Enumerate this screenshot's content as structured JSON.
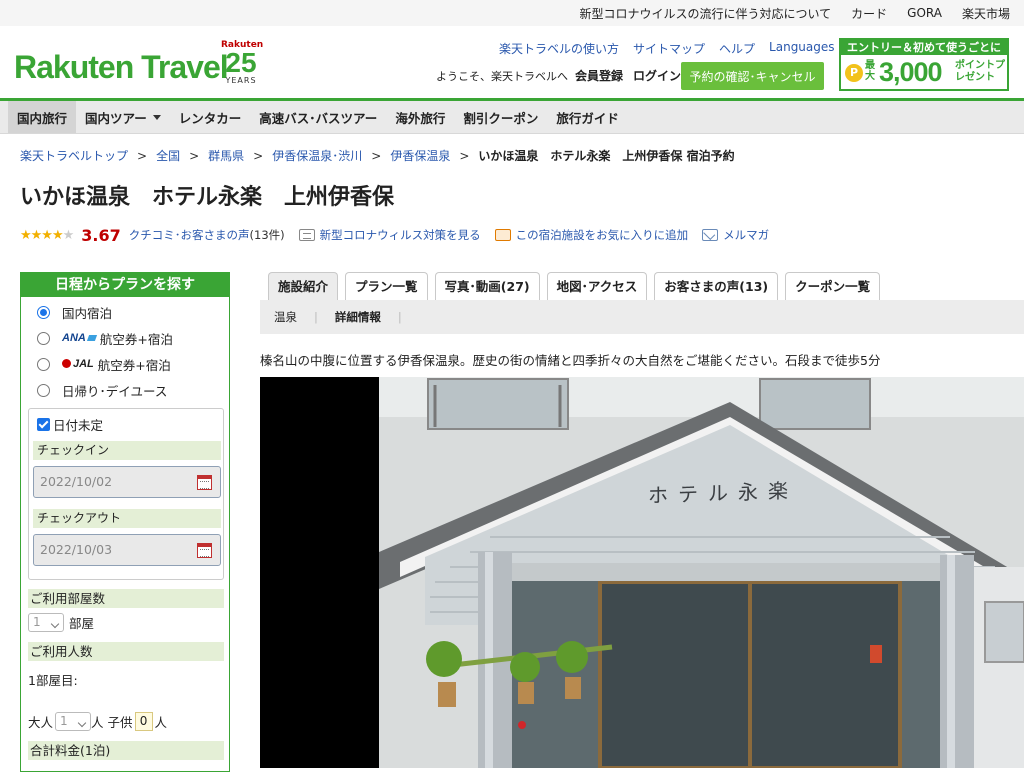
{
  "topbar": {
    "links": [
      "新型コロナウイルスの流行に伴う対応について",
      "カード",
      "GORA",
      "楽天市場"
    ]
  },
  "header": {
    "logo": "Rakuten Travel",
    "anniversary": {
      "brand": "Rakuten",
      "number": "25",
      "suffix": "YEARS"
    },
    "links": [
      "楽天トラベルの使い方",
      "サイトマップ",
      "ヘルプ",
      "Languages"
    ],
    "welcome": "ようこそ、楽天トラベルへ",
    "register": "会員登録",
    "login": "ログイン",
    "reserve_button": "予約の確認･キャンセル",
    "promo": {
      "top": "エントリー＆初めて使うごとに",
      "coin": "P",
      "max": "最大",
      "points": "3,000",
      "unit": "ポイントプレゼント"
    }
  },
  "nav": {
    "items": [
      "国内旅行",
      "国内ツアー",
      "レンタカー",
      "高速バス･バスツアー",
      "海外旅行",
      "割引クーポン",
      "旅行ガイド"
    ],
    "active": "国内旅行"
  },
  "breadcrumb": {
    "items": [
      "楽天トラベルトップ",
      "全国",
      "群馬県",
      "伊香保温泉･渋川",
      "伊香保温泉"
    ],
    "current": "いかほ温泉　ホテル永楽　上州伊香保 宿泊予約",
    "separator": ">"
  },
  "hotel": {
    "title": "いかほ温泉　ホテル永楽　上州伊香保",
    "rating_stars": 3.67,
    "rating_score": "3.67",
    "reviews_label": "クチコミ･お客さまの声",
    "reviews_count": "(13件)",
    "covid_link": "新型コロナウィルス対策を見る",
    "favorite_link": "この宿泊施設をお気に入りに追加",
    "mail_link": "メルマガ",
    "description": "榛名山の中腹に位置する伊香保温泉。歴史の街の情緒と四季折々の大自然をご堪能ください。石段まで徒歩5分"
  },
  "search_panel": {
    "heading": "日程からプランを探す",
    "options": [
      {
        "label": "国内宿泊",
        "selected": true,
        "brand": ""
      },
      {
        "label": "航空券+宿泊",
        "selected": false,
        "brand": "ANA"
      },
      {
        "label": "航空券+宿泊",
        "selected": false,
        "brand": "JAL"
      },
      {
        "label": "日帰り･デイユース",
        "selected": false,
        "brand": ""
      }
    ],
    "undecided_label": "日付未定",
    "undecided_checked": true,
    "checkin_label": "チェックイン",
    "checkin_value": "2022/10/02",
    "checkout_label": "チェックアウト",
    "checkout_value": "2022/10/03",
    "rooms_label": "ご利用部屋数",
    "rooms_value": "1",
    "rooms_unit": "部屋",
    "guests_label": "ご利用人数",
    "room1_label": "1部屋目:",
    "adult_label": "大人",
    "adult_value": "1",
    "adult_unit": "人",
    "child_label": "子供",
    "child_value": "0",
    "child_unit": "人",
    "total_label": "合計料金(1泊)"
  },
  "tabs": {
    "items": [
      {
        "label": "施設紹介",
        "count": ""
      },
      {
        "label": "プラン一覧",
        "count": ""
      },
      {
        "label": "写真･動画",
        "count": "(27)"
      },
      {
        "label": "地図･アクセス",
        "count": ""
      },
      {
        "label": "お客さまの声",
        "count": "(13)"
      },
      {
        "label": "クーポン一覧",
        "count": ""
      }
    ],
    "active": "施設紹介",
    "subtabs": [
      "温泉",
      "詳細情報"
    ],
    "active_subtab": "詳細情報"
  },
  "photo": {
    "sign_text": "ホテル永楽"
  },
  "colors": {
    "brand_green": "#3aa535",
    "link_blue": "#2a58ad",
    "score_red": "#bf0000",
    "star_yellow": "#f2b000"
  }
}
